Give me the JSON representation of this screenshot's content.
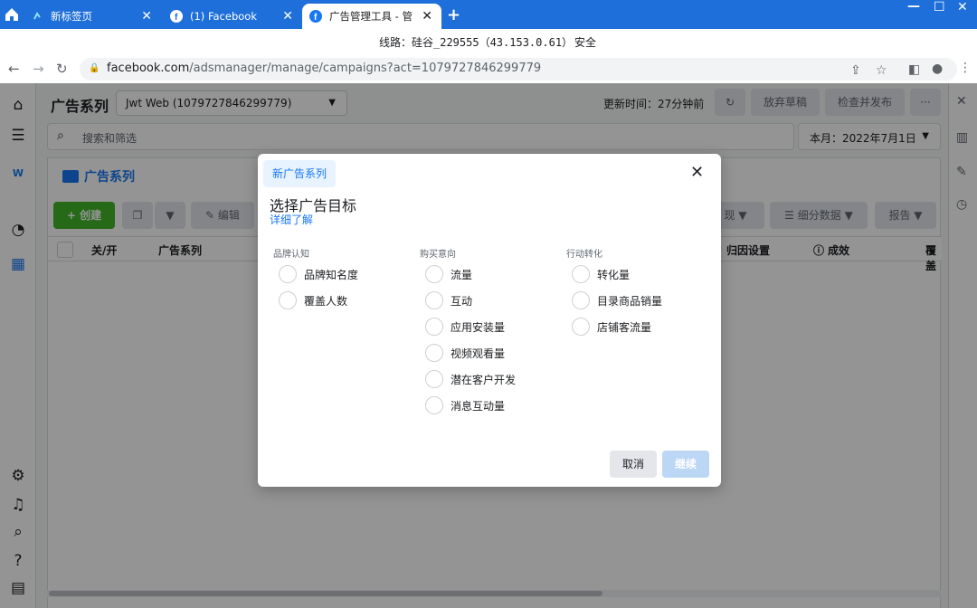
{
  "browser": {
    "tabs": [
      {
        "label": "新标签页"
      },
      {
        "label": "(1) Facebook"
      },
      {
        "label": "广告管理工具 - 管"
      }
    ],
    "new_tab": "+",
    "close": "✕",
    "notice": {
      "line": "线路：硅谷_229555（43.153.0.61）",
      "safe": "安全"
    },
    "url_host": "facebook.com",
    "url_path": "/adsmanager/manage/campaigns?act=1079727846299779"
  },
  "header": {
    "title": "广告系列",
    "account": "Jwt Web (1079727846299779)",
    "updated": "更新时间：27分钟前",
    "discard": "放弃草稿",
    "review": "检查并发布",
    "more": "···"
  },
  "search": {
    "placeholder": "搜索和筛选"
  },
  "date_range": "本月：2022年7月1日",
  "panel": {
    "tab": "广告系列",
    "create": "创建",
    "edit": "编辑",
    "performance": "现",
    "breakdown": "细分数据",
    "report": "报告"
  },
  "table": {
    "columns": [
      "关/开",
      "广告系列",
      "归因设置",
      "成效",
      "覆盖"
    ]
  },
  "modal": {
    "tag": "新广告系列",
    "title": "选择广告目标",
    "learn_more": "详细了解",
    "groups": [
      {
        "label": "品牌认知",
        "options": [
          "品牌知名度",
          "覆盖人数"
        ]
      },
      {
        "label": "购买意向",
        "options": [
          "流量",
          "互动",
          "应用安装量",
          "视频观看量",
          "潜在客户开发",
          "消息互动量"
        ]
      },
      {
        "label": "行动转化",
        "options": [
          "转化量",
          "目录商品销量",
          "店铺客流量"
        ]
      }
    ],
    "cancel": "取消",
    "continue": "继续"
  },
  "colors": {
    "accent": "#1877f2",
    "create": "#42b72a",
    "browser": "#1e6fd9"
  }
}
